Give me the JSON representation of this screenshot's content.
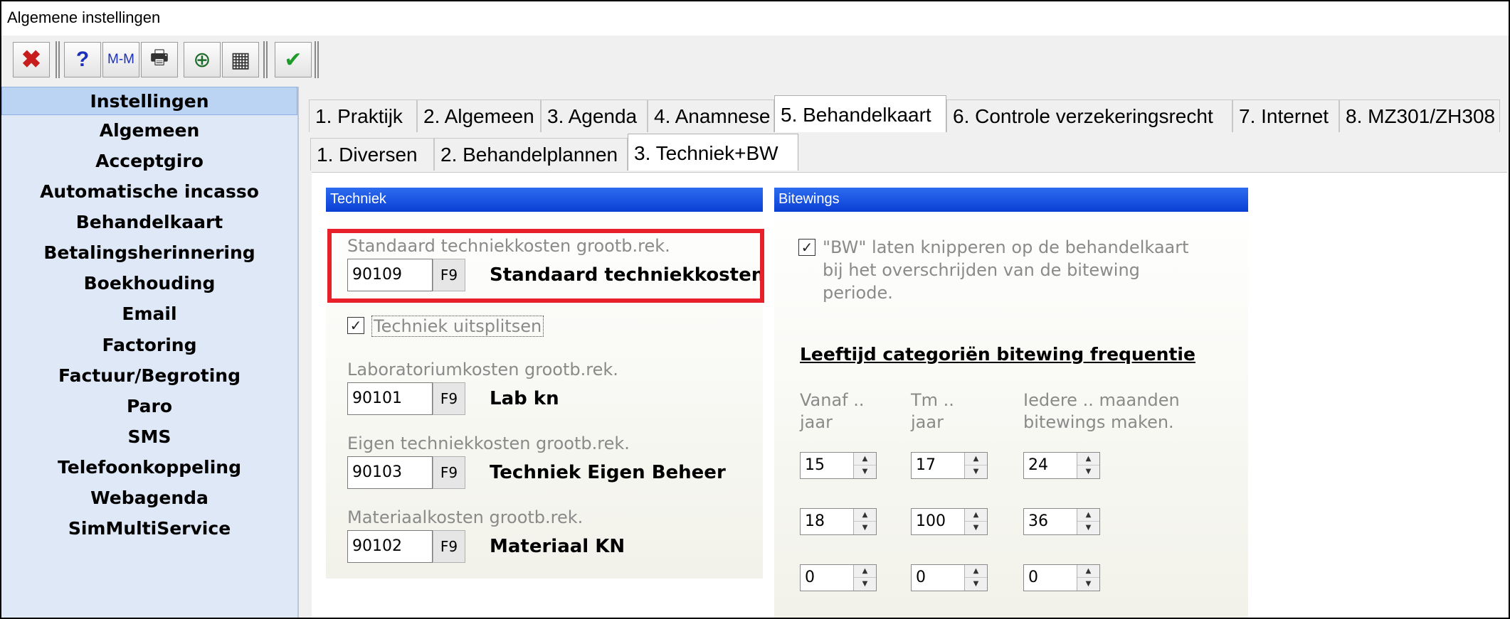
{
  "window": {
    "title": "Algemene instellingen"
  },
  "toolbar": {
    "buttons": [
      {
        "name": "close-button",
        "icon": "x-icon",
        "glyph": "✖",
        "color": "#c81d1d"
      },
      {
        "name": "help-button",
        "icon": "question-icon",
        "glyph": "?",
        "color": "#1b2fb8"
      },
      {
        "name": "mm-button",
        "icon": "mm-icon",
        "glyph": "M-M",
        "color": "#1b2fb8"
      },
      {
        "name": "print-button",
        "icon": "printer-icon",
        "glyph": "🖶",
        "color": "#333333"
      },
      {
        "name": "globe-button",
        "icon": "globe-icon",
        "glyph": "⊕",
        "color": "#1c6b2a"
      },
      {
        "name": "calculator-button",
        "icon": "calculator-icon",
        "glyph": "▦",
        "color": "#333333"
      },
      {
        "name": "confirm-button",
        "icon": "check-icon",
        "glyph": "✔",
        "color": "#1e9b2a"
      }
    ]
  },
  "sidebar": {
    "items": [
      {
        "label": "Instellingen",
        "active": true
      },
      {
        "label": "Algemeen"
      },
      {
        "label": "Acceptgiro"
      },
      {
        "label": "Automatische incasso"
      },
      {
        "label": "Behandelkaart"
      },
      {
        "label": "Betalingsherinnering"
      },
      {
        "label": "Boekhouding"
      },
      {
        "label": "Email"
      },
      {
        "label": "Factoring"
      },
      {
        "label": "Factuur/Begroting"
      },
      {
        "label": "Paro"
      },
      {
        "label": "SMS"
      },
      {
        "label": "Telefoonkoppeling"
      },
      {
        "label": "Webagenda"
      },
      {
        "label": "SimMultiService"
      }
    ]
  },
  "tabs": [
    {
      "label": "1. Praktijk"
    },
    {
      "label": "2. Algemeen"
    },
    {
      "label": "3. Agenda"
    },
    {
      "label": "4. Anamnese"
    },
    {
      "label": "5. Behandelkaart",
      "active": true
    },
    {
      "label": "6. Controle verzekeringsrecht"
    },
    {
      "label": "7. Internet"
    },
    {
      "label": "8. MZ301/ZH308"
    }
  ],
  "subtabs": [
    {
      "label": "1. Diversen"
    },
    {
      "label": "2. Behandelplannen"
    },
    {
      "label": "3. Techniek+BW",
      "active": true
    }
  ],
  "techniek": {
    "header": "Techniek",
    "standard": {
      "caption": "Standaard techniekkosten grootb.rek.",
      "value": "90109",
      "f9": "F9",
      "name": "Standaard techniekkosten"
    },
    "split": {
      "label": "Techniek uitsplitsen",
      "checked": true,
      "check_glyph": "✓"
    },
    "lab": {
      "caption": "Laboratoriumkosten grootb.rek.",
      "value": "90101",
      "f9": "F9",
      "name": "Lab kn"
    },
    "eigen": {
      "caption": "Eigen techniekkosten grootb.rek.",
      "value": "90103",
      "f9": "F9",
      "name": "Techniek Eigen Beheer"
    },
    "materiaal": {
      "caption": "Materiaalkosten grootb.rek.",
      "value": "90102",
      "f9": "F9",
      "name": "Materiaal KN"
    }
  },
  "bitewings": {
    "header": "Bitewings",
    "blink": {
      "label_lines": [
        "\"BW\" laten knipperen op de behandelkaart",
        "bij het overschrijden van de bitewing",
        "periode."
      ],
      "checked": true,
      "check_glyph": "✓"
    },
    "section_title": "Leeftijd categoriën bitewing frequentie",
    "columns": [
      {
        "lines": [
          "Vanaf ..",
          "jaar"
        ]
      },
      {
        "lines": [
          "Tm ..",
          "jaar"
        ]
      },
      {
        "lines": [
          "Iedere .. maanden",
          "bitewings maken."
        ]
      }
    ],
    "rows": [
      [
        "15",
        "17",
        "24"
      ],
      [
        "18",
        "100",
        "36"
      ],
      [
        "0",
        "0",
        "0"
      ]
    ],
    "spin_up": "▲",
    "spin_down": "▼"
  }
}
